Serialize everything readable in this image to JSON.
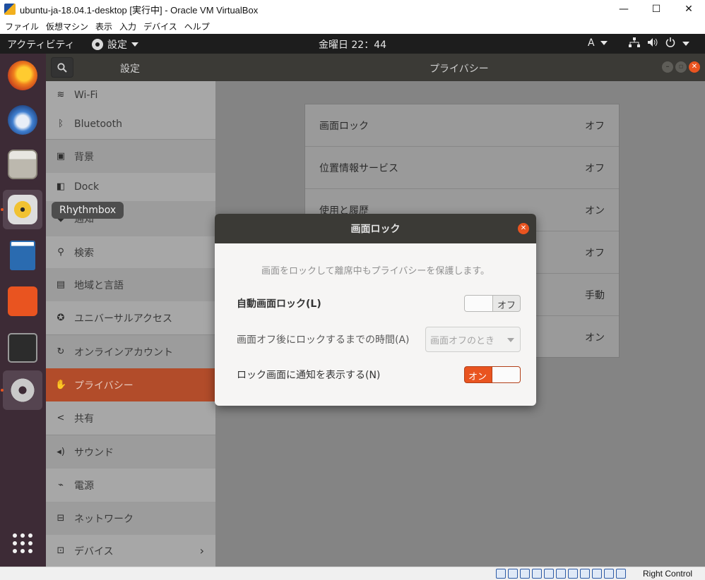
{
  "host_window": {
    "title": "ubuntu-ja-18.04.1-desktop [実行中] - Oracle VM VirtualBox",
    "minimize": "—",
    "maximize": "☐",
    "close": "✕",
    "menu": [
      "ファイル",
      "仮想マシン",
      "表示",
      "入力",
      "デバイス",
      "ヘルプ"
    ]
  },
  "topbar": {
    "activities": "アクティビティ",
    "app_menu": "設定",
    "clock": "金曜日 22：44",
    "input_method": "A",
    "network_icon": "network-icon",
    "volume_icon": "volume-icon",
    "power_icon": "power-icon"
  },
  "dock": {
    "apps": [
      "Firefox",
      "Thunderbird",
      "Files",
      "Rhythmbox",
      "LibreOffice Writer",
      "Ubuntu Software",
      "Terminal",
      "Settings"
    ],
    "tooltip": "Rhythmbox",
    "show_apps_icon": "apps-grid-icon"
  },
  "settings": {
    "left_title": "設定",
    "right_title": "プライバシー",
    "sidebar": [
      {
        "label": "Wi-Fi",
        "icon": "wifi-icon"
      },
      {
        "label": "Bluetooth",
        "icon": "bluetooth-icon"
      },
      {
        "label": "背景",
        "icon": "background-icon"
      },
      {
        "label": "Dock",
        "icon": "dock-icon"
      },
      {
        "label": "通知",
        "icon": "notification-icon"
      },
      {
        "label": "検索",
        "icon": "search-icon"
      },
      {
        "label": "地域と言語",
        "icon": "region-icon"
      },
      {
        "label": "ユニバーサルアクセス",
        "icon": "accessibility-icon"
      },
      {
        "label": "オンラインアカウント",
        "icon": "online-accounts-icon"
      },
      {
        "label": "プライバシー",
        "icon": "privacy-icon"
      },
      {
        "label": "共有",
        "icon": "share-icon"
      },
      {
        "label": "サウンド",
        "icon": "sound-icon"
      },
      {
        "label": "電源",
        "icon": "power-icon"
      },
      {
        "label": "ネットワーク",
        "icon": "network-icon"
      },
      {
        "label": "デバイス",
        "icon": "devices-icon"
      }
    ],
    "selected_item": "プライバシー",
    "privacy_rows": [
      {
        "label": "画面ロック",
        "value": "オフ"
      },
      {
        "label": "位置情報サービス",
        "value": "オフ"
      },
      {
        "label": "使用と履歴",
        "value": "オン"
      },
      {
        "label": "",
        "value": "オフ"
      },
      {
        "label": "",
        "value": "手動"
      },
      {
        "label": "",
        "value": "オン"
      }
    ]
  },
  "dialog": {
    "title": "画面ロック",
    "description": "画面をロックして離席中もプライバシーを保護します。",
    "auto_lock_label": "自動画面ロック(L)",
    "auto_lock_state": "オフ",
    "delay_label": "画面オフ後にロックするまでの時間(A)",
    "delay_value": "画面オフのとき",
    "notifications_label": "ロック画面に通知を表示する(N)",
    "notifications_state": "オン"
  },
  "statusbar": {
    "host_key": "Right Control"
  },
  "colors": {
    "accent": "#e95420",
    "topbar": "#1d1d1d",
    "dock": "#3d2b36",
    "headerbar": "#3b3a36"
  }
}
